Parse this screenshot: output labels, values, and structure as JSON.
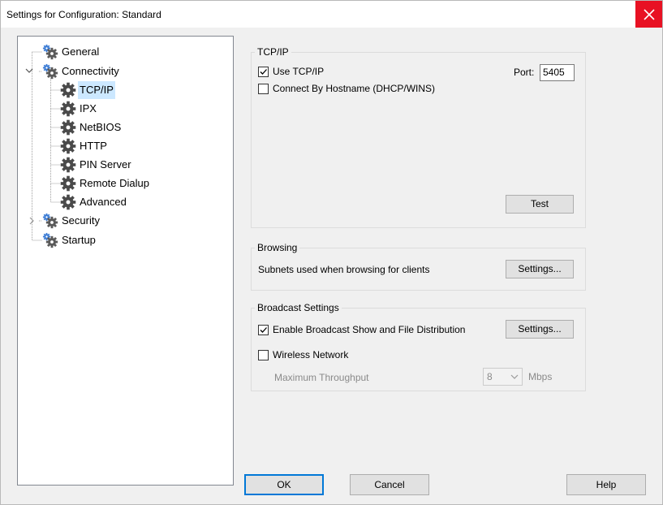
{
  "window": {
    "title": "Settings for Configuration: Standard",
    "close_icon": "close-icon"
  },
  "tree": {
    "items": [
      {
        "label": "General",
        "icon": "gear-cluster-icon",
        "expander": ""
      },
      {
        "label": "Connectivity",
        "icon": "gear-cluster-icon",
        "expander": "expanded"
      },
      {
        "label": "TCP/IP",
        "icon": "gear-icon",
        "expander": ""
      },
      {
        "label": "IPX",
        "icon": "gear-icon",
        "expander": ""
      },
      {
        "label": "NetBIOS",
        "icon": "gear-icon",
        "expander": ""
      },
      {
        "label": "HTTP",
        "icon": "gear-icon",
        "expander": ""
      },
      {
        "label": "PIN Server",
        "icon": "gear-icon",
        "expander": ""
      },
      {
        "label": "Remote Dialup",
        "icon": "gear-icon",
        "expander": ""
      },
      {
        "label": "Advanced",
        "icon": "gear-icon",
        "expander": ""
      },
      {
        "label": "Security",
        "icon": "gear-cluster-icon",
        "expander": "collapsed"
      },
      {
        "label": "Startup",
        "icon": "gear-cluster-icon",
        "expander": ""
      }
    ],
    "selected": "TCP/IP",
    "selection_color": "#cce8ff"
  },
  "tcpip": {
    "legend": "TCP/IP",
    "use_tcpip": {
      "label": "Use TCP/IP",
      "checked": true
    },
    "connect_by_hostname": {
      "label": "Connect By Hostname (DHCP/WINS)",
      "checked": false
    },
    "port_label": "Port:",
    "port_value": "5405",
    "test_button": "Test"
  },
  "browsing": {
    "legend": "Browsing",
    "description": "Subnets used when browsing for clients",
    "settings_button": "Settings..."
  },
  "broadcast": {
    "legend": "Broadcast Settings",
    "enable_broadcast": {
      "label": "Enable Broadcast Show and File Distribution",
      "checked": true
    },
    "settings_button": "Settings...",
    "wireless": {
      "label": "Wireless Network",
      "checked": false
    },
    "max_throughput_label": "Maximum Throughput",
    "throughput_value": "8",
    "throughput_unit": "Mbps"
  },
  "footer": {
    "ok": "OK",
    "cancel": "Cancel",
    "help": "Help"
  },
  "colors": {
    "close_bg": "#e81123",
    "default_button_border": "#0078d7"
  }
}
